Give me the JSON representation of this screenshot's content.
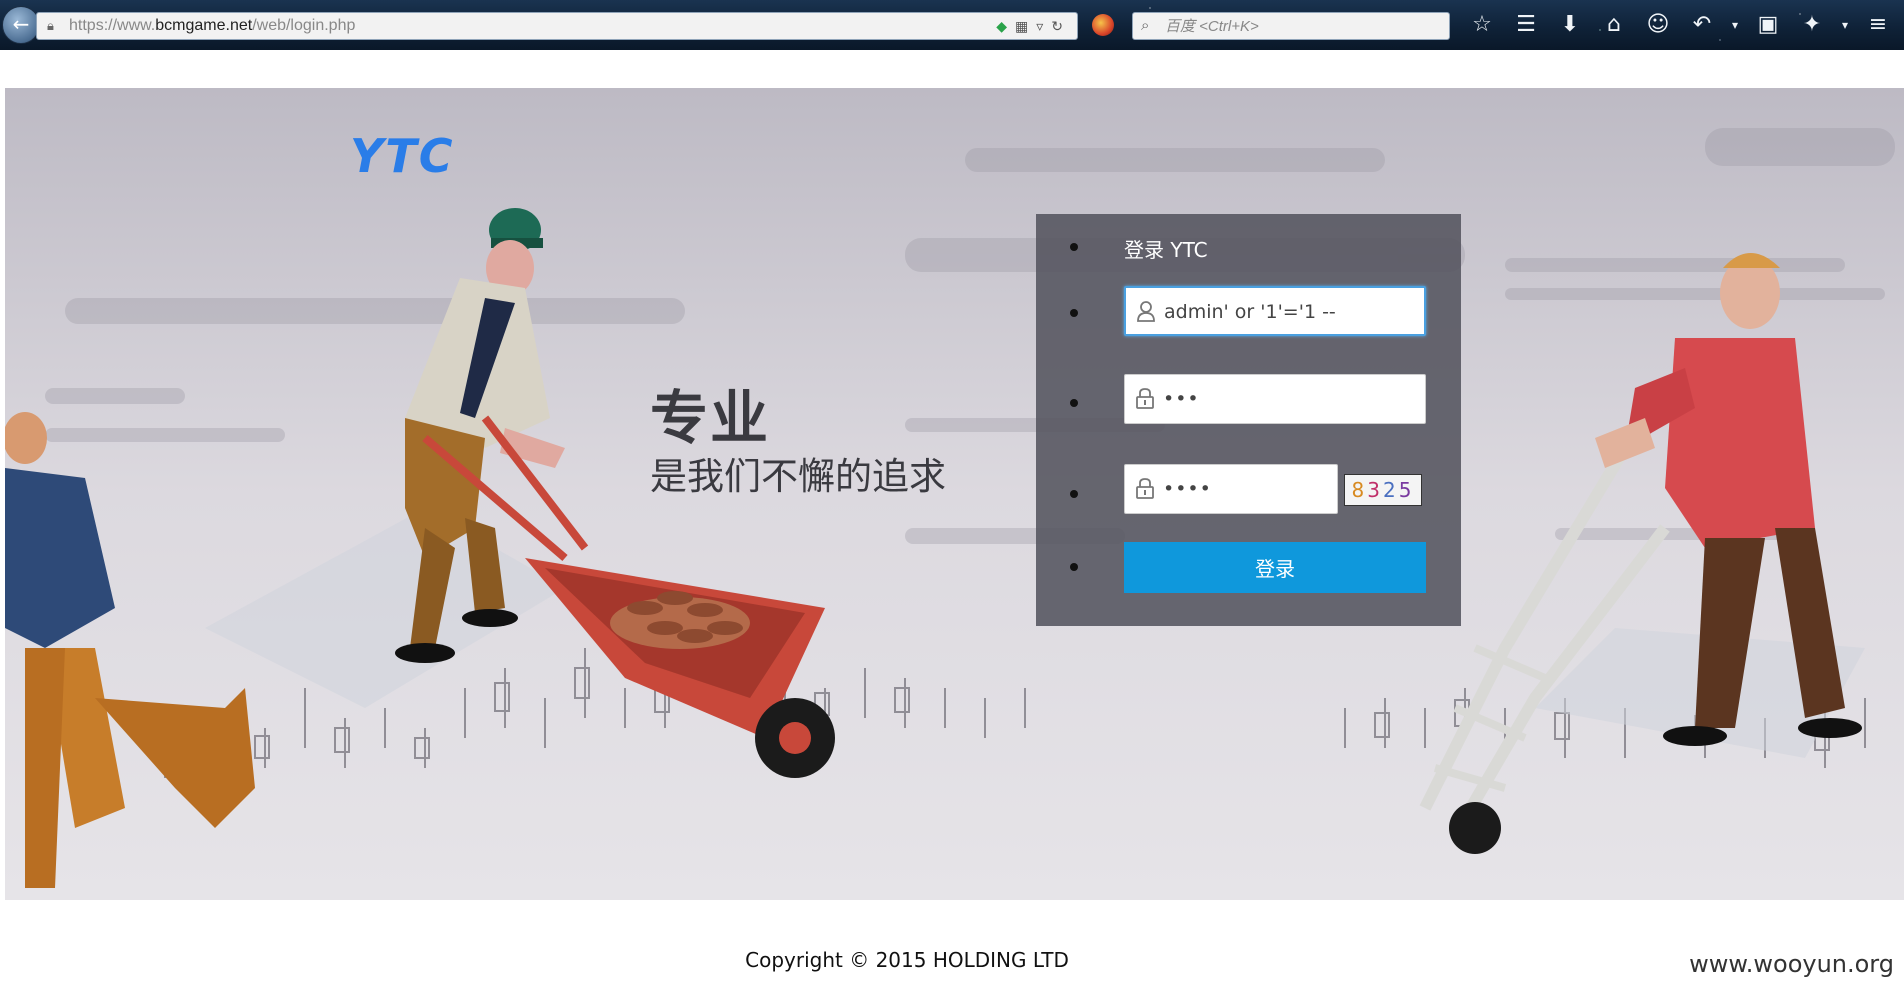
{
  "browser": {
    "url_prefix": "https://www.",
    "url_domain": "bcmgame.net",
    "url_path": "/web/login.php",
    "search_placeholder": "百度 <Ctrl+K>"
  },
  "hero": {
    "logo_text": "YTC",
    "slogan_title": "专业",
    "slogan_sub": "是我们不懈的追求"
  },
  "login": {
    "title": "登录 YTC",
    "username_value": "admin' or '1'='1 --",
    "password_value": "•••",
    "captcha_input_value": "••••",
    "captcha_digits": [
      "8",
      "3",
      "2",
      "5"
    ],
    "submit_label": "登录"
  },
  "footer": {
    "copyright": "Copyright © 2015 HOLDING LTD",
    "watermark": "www.wooyun.org"
  },
  "colors": {
    "button_blue": "#0f98dc",
    "logo_blue": "#2a7de8",
    "panel_bg": "#54545e"
  }
}
